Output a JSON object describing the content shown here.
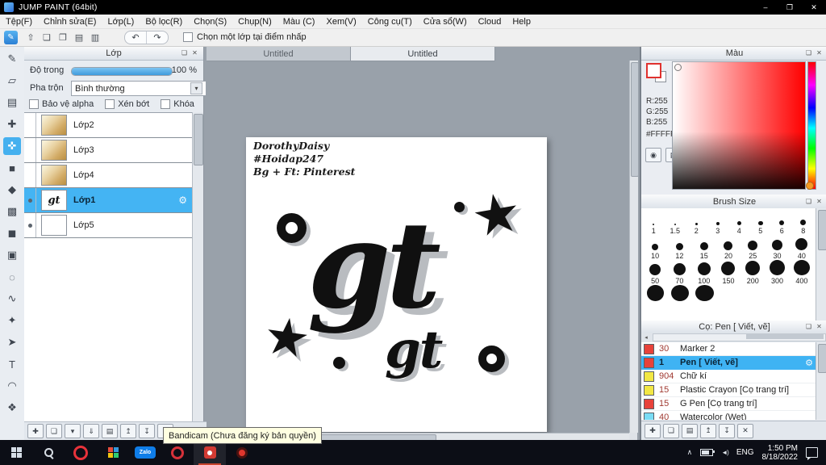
{
  "window": {
    "title": "JUMP PAINT (64bit)",
    "controls": {
      "minimize": "–",
      "maximize": "❐",
      "close": "✕"
    }
  },
  "menu": {
    "items": [
      "Tệp(F)",
      "Chỉnh sửa(E)",
      "Lớp(L)",
      "Bộ lọc(R)",
      "Chọn(S)",
      "Chụp(N)",
      "Màu (C)",
      "Xem(V)",
      "Công cụ(T)",
      "Cửa sổ(W)",
      "Cloud",
      "Help"
    ]
  },
  "toolbar": {
    "main_glyph": "✎",
    "icons": [
      {
        "name": "export",
        "glyph": "⇧"
      },
      {
        "name": "comment",
        "glyph": "❏"
      },
      {
        "name": "panels",
        "glyph": "❐"
      },
      {
        "name": "workspace-grid",
        "glyph": "▤"
      },
      {
        "name": "workspace-list",
        "glyph": "▥"
      }
    ],
    "undo": "↶",
    "redo": "↷",
    "snap_label": "Chọn một lớp tại điểm nhấp"
  },
  "tools": [
    {
      "name": "pen",
      "glyph": "✎"
    },
    {
      "name": "eraser",
      "glyph": "▱"
    },
    {
      "name": "airbrush",
      "glyph": "▤"
    },
    {
      "name": "divide",
      "glyph": "✚"
    },
    {
      "name": "move",
      "glyph": "✜",
      "selected": true
    },
    {
      "name": "rect",
      "glyph": "■"
    },
    {
      "name": "bucket",
      "glyph": "◆"
    },
    {
      "name": "gradient",
      "glyph": "▩"
    },
    {
      "name": "fill-dark",
      "glyph": "◼"
    },
    {
      "name": "select-rect",
      "glyph": "▣"
    },
    {
      "name": "select-ellipse",
      "glyph": "◌"
    },
    {
      "name": "lasso",
      "glyph": "∿"
    },
    {
      "name": "magic-wand",
      "glyph": "✦"
    },
    {
      "name": "operate",
      "glyph": "➤"
    },
    {
      "name": "text",
      "glyph": "T"
    },
    {
      "name": "curve",
      "glyph": "◠"
    },
    {
      "name": "pan",
      "glyph": "❖"
    }
  ],
  "icons": {
    "float": "❏",
    "close": "✕",
    "gear": "⚙",
    "dropdown": "▾",
    "scroll-left": "◂"
  },
  "layers_panel": {
    "title": "Lớp",
    "opacity_label": "Độ trong",
    "opacity_value": "100 %",
    "blend_label": "Pha trộn",
    "blend_value": "Bình thường",
    "options": [
      {
        "label": "Bảo vệ alpha"
      },
      {
        "label": "Xén bớt"
      },
      {
        "label": "Khóa"
      }
    ],
    "layers": [
      {
        "name": "Lớp2",
        "thumb": "paint",
        "visible": false
      },
      {
        "name": "Lớp3",
        "thumb": "paint",
        "visible": false
      },
      {
        "name": "Lớp4",
        "thumb": "paint",
        "visible": false
      },
      {
        "name": "Lớp1",
        "thumb": "gt",
        "thumb_text": "gt",
        "visible": true,
        "selected": true
      },
      {
        "name": "Lớp5",
        "thumb": "blank",
        "visible": true
      }
    ]
  },
  "layer_toolbar": [
    {
      "name": "new-layer",
      "glyph": "✚"
    },
    {
      "name": "duplicate-layer",
      "glyph": "❏"
    },
    {
      "name": "layer-menu",
      "glyph": "▾"
    },
    {
      "name": "merge-down",
      "glyph": "⇓"
    },
    {
      "name": "layer-folder",
      "glyph": "▤"
    },
    {
      "name": "move-layer-up",
      "glyph": "↥"
    },
    {
      "name": "move-layer-down",
      "glyph": "↧"
    },
    {
      "name": "delete-layer",
      "glyph": "✕"
    }
  ],
  "canvas": {
    "tabs": [
      {
        "label": "Untitled"
      },
      {
        "label": "Untitled",
        "selected": true
      }
    ],
    "artwork": {
      "credits": [
        "DorothyDaisy",
        "#Hoidap247",
        "Bg + Ft: Pinterest"
      ],
      "big_text": "gt",
      "small_text": "gt",
      "star": "★"
    }
  },
  "color_panel": {
    "title": "Màu",
    "r": "R:255",
    "g": "G:255",
    "b": "B:255",
    "hex": "#FFFFFF",
    "selected_color": "#FFFFFF",
    "hue_color": "#FF0000",
    "buttons": [
      {
        "name": "eyedropper",
        "glyph": "◉"
      },
      {
        "name": "palette",
        "glyph": "▦"
      }
    ]
  },
  "brush_size_panel": {
    "title": "Brush Size",
    "rows": {
      "r1": [
        {
          "label": "1",
          "d": 2
        },
        {
          "label": "1.5",
          "d": 2.5
        },
        {
          "label": "2",
          "d": 3
        },
        {
          "label": "3",
          "d": 4
        },
        {
          "label": "4",
          "d": 5
        },
        {
          "label": "5",
          "d": 5.5
        },
        {
          "label": "6",
          "d": 6
        },
        {
          "label": "8",
          "d": 7
        }
      ],
      "r2": [
        {
          "label": "10",
          "d": 8
        },
        {
          "label": "12",
          "d": 9
        },
        {
          "label": "15",
          "d": 10
        },
        {
          "label": "20",
          "d": 11
        },
        {
          "label": "25",
          "d": 12
        },
        {
          "label": "30",
          "d": 13
        },
        {
          "label": "40",
          "d": 15
        }
      ],
      "r3": [
        {
          "label": "50",
          "d": 14
        },
        {
          "label": "70",
          "d": 15
        },
        {
          "label": "100",
          "d": 16
        },
        {
          "label": "150",
          "d": 17
        },
        {
          "label": "200",
          "d": 18
        },
        {
          "label": "300",
          "d": 19
        },
        {
          "label": "400",
          "d": 20
        }
      ],
      "r4": [
        {
          "label": "",
          "d": 21
        },
        {
          "label": "",
          "d": 22
        },
        {
          "label": "",
          "d": 23
        }
      ]
    }
  },
  "brush_panel": {
    "title": "Cọ: Pen [ Viết, vẽ]",
    "brushes": [
      {
        "size": "30",
        "name": "Marker 2",
        "color": "#e8423a"
      },
      {
        "size": "1",
        "name": "Pen [ Viết, vẽ]",
        "color": "#e8423a",
        "selected": true
      },
      {
        "size": "904",
        "name": "Chữ kí",
        "color": "#f2e744"
      },
      {
        "size": "15",
        "name": "Plastic Crayon [Cọ trang trí]",
        "color": "#f2e744"
      },
      {
        "size": "15",
        "name": "G Pen [Cọ trang trí]",
        "color": "#e8423a"
      },
      {
        "size": "40",
        "name": "Watercolor (Wet)",
        "color": "#7adcf5"
      }
    ]
  },
  "brush_toolbar": [
    {
      "name": "add-brush",
      "glyph": "✚"
    },
    {
      "name": "duplicate-brush",
      "glyph": "❏"
    },
    {
      "name": "brush-folder",
      "glyph": "▤"
    },
    {
      "name": "brush-up",
      "glyph": "↥"
    },
    {
      "name": "brush-down",
      "glyph": "↧"
    },
    {
      "name": "delete-brush",
      "glyph": "✕"
    }
  ],
  "taskbar": {
    "zalo_label": "Zalo",
    "lang": "ENG",
    "time": "1:50 PM",
    "date": "8/18/2022",
    "tooltip": "Bandicam (Chưa đăng ký bản quyền)"
  }
}
